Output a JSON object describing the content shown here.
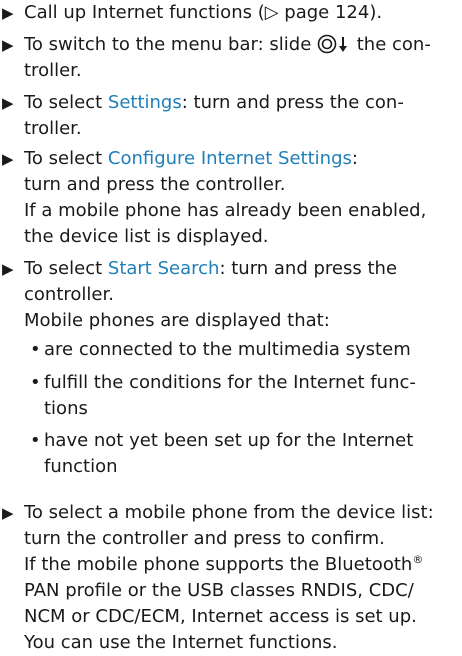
{
  "steps": [
    {
      "lines": [
        "Call up Internet functions (▷ page 124)."
      ]
    },
    {
      "lines": [
        "To switch to the menu bar: slide",
        "the con-",
        "troller."
      ]
    },
    {
      "term": "Settings",
      "lines": [
        "To select",
        ": turn and press the con-",
        "troller."
      ]
    },
    {
      "term": "Configure Internet Settings",
      "lines": [
        "To select",
        ":",
        "turn and press the controller.",
        "If a mobile phone has already been enabled,",
        "the device list is displayed."
      ]
    },
    {
      "term": "Start Search",
      "lines": [
        "To select",
        ": turn and press the",
        "controller.",
        "Mobile phones are displayed that:"
      ]
    },
    {
      "lines": [
        "To select a mobile phone from the device list:",
        "turn the controller and press to confirm.",
        "If the mobile phone supports the Bluetooth",
        "PAN profile or the USB classes RNDIS, CDC/",
        "NCM or CDC/ECM, Internet access is set up.",
        "You can use the Internet functions."
      ],
      "registered": "®"
    }
  ],
  "conditions": [
    [
      "are connected to the multimedia system"
    ],
    [
      "fulfill the conditions for the Internet func-",
      "tions"
    ],
    [
      "have not yet been set up for the Internet",
      "function"
    ]
  ],
  "icons": {
    "step_marker": "triangle-right-icon",
    "controller": "controller-slide-down-icon"
  }
}
